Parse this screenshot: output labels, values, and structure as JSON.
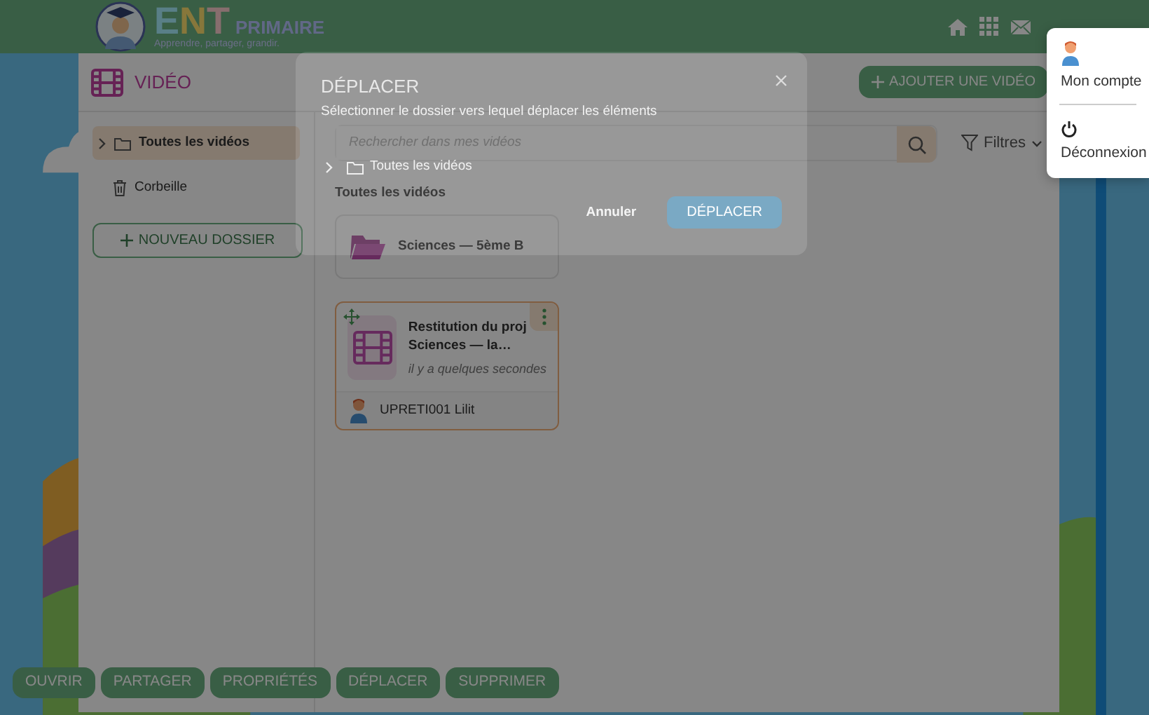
{
  "header": {
    "logo": {
      "letters": [
        "E",
        "N",
        "T"
      ],
      "word": "PRIMAIRE",
      "tagline": "Apprendre, partager, grandir."
    }
  },
  "app": {
    "title": "VIDÉO",
    "add_button": "AJOUTER UNE VIDÉO"
  },
  "sidebar": {
    "items": [
      {
        "kind": "folder",
        "label": "Toutes les vidéos",
        "selected": true
      },
      {
        "kind": "trash",
        "label": "Corbeille",
        "selected": false
      }
    ],
    "new_folder_button": "NOUVEAU DOSSIER"
  },
  "search": {
    "placeholder": "Rechercher dans mes vidéos"
  },
  "filters": "Filtres",
  "content": {
    "heading": "Toutes les vidéos",
    "folders": [
      {
        "name": "Sciences — 5ème B"
      }
    ],
    "videos": [
      {
        "title": "Restitution du proj Sciences — la…",
        "time": "il y a quelques secondes",
        "author": "UPRETI001 Lilit",
        "selected": true
      }
    ]
  },
  "action_bar": [
    "OUVRIR",
    "PARTAGER",
    "PROPRIÉTÉS",
    "DÉPLACER",
    "SUPPRIMER"
  ],
  "modal": {
    "title": "DÉPLACER",
    "subtitle": "Sélectionner le dossier vers lequel déplacer les éléments",
    "tree": [
      {
        "label": "Toutes les vidéos"
      }
    ],
    "cancel": "Annuler",
    "confirm": {
      "label": "DÉPLACER",
      "disabled": true
    }
  },
  "user_menu": [
    {
      "kind": "account",
      "label": "Mon compte"
    },
    {
      "kind": "logout",
      "label": "Déconnexion"
    }
  ]
}
